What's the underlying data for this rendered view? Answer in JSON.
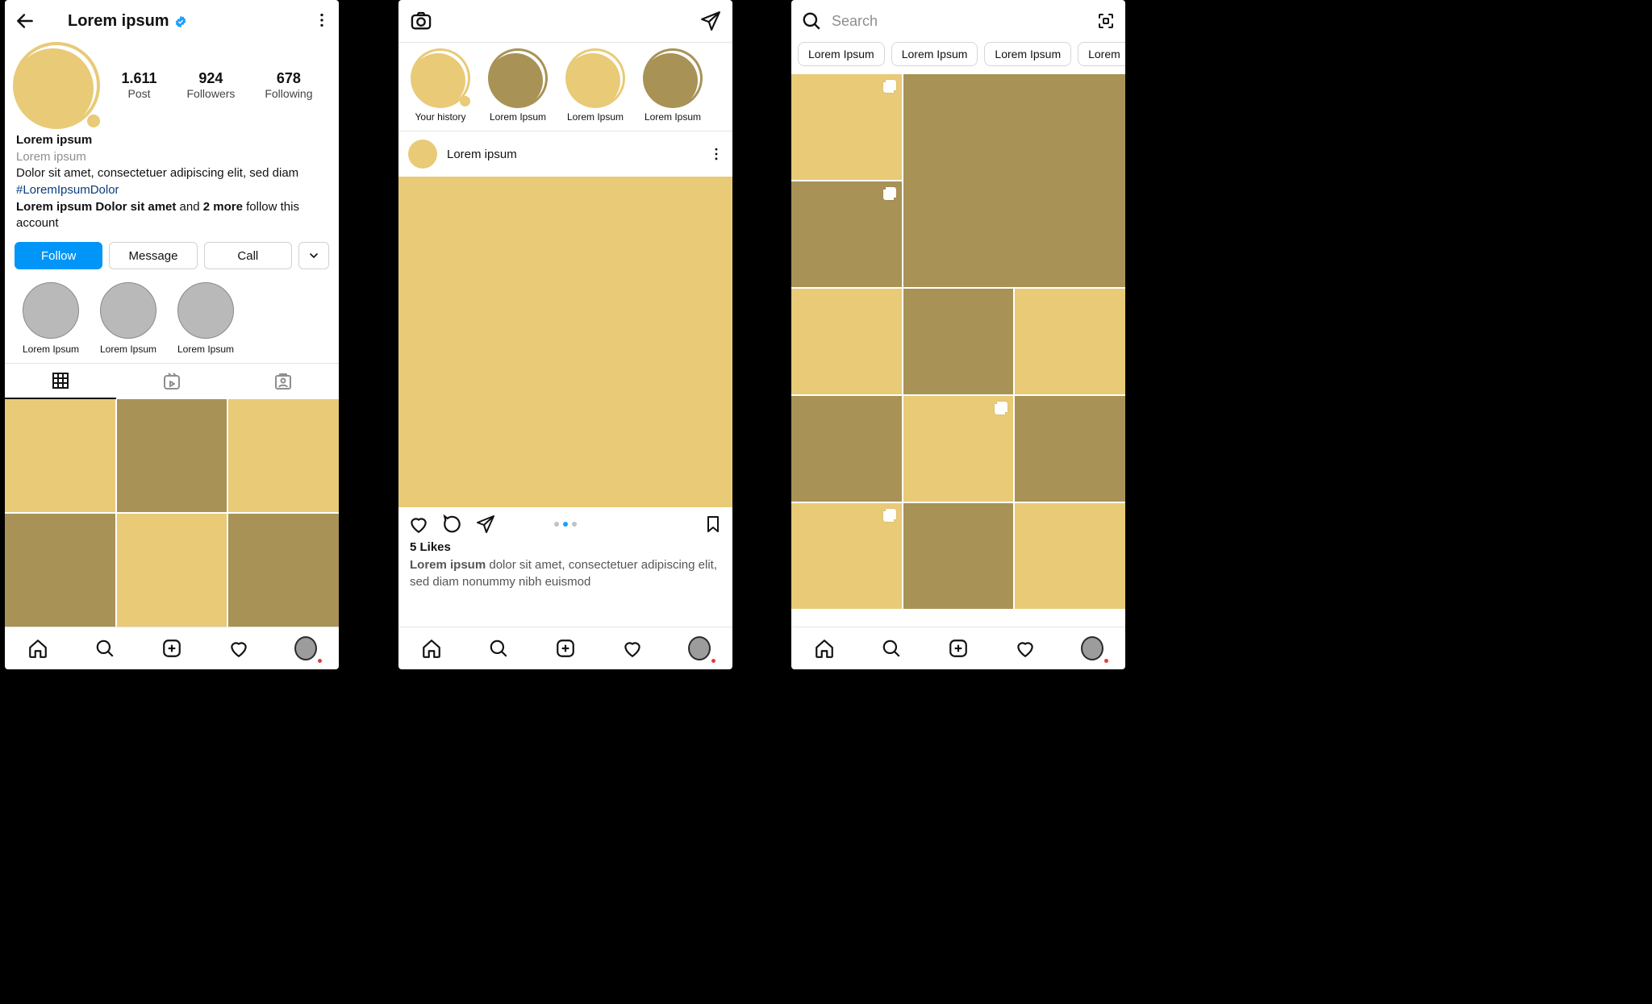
{
  "profile": {
    "username": "Lorem ipsum",
    "posts_count": "1.611",
    "posts_label": "Post",
    "followers_count": "924",
    "followers_label": "Followers",
    "following_count": "678",
    "following_label": "Following",
    "display_name": "Lorem ipsum",
    "category": "Lorem ipsum",
    "bio_pre": "Dolor sit amet, consectetuer adipiscing elit, sed diam ",
    "bio_hash": "#LoremIpsumDolor",
    "followed_by_name": "Lorem ipsum Dolor sit amet",
    "followed_by_mid": " and ",
    "followed_by_count": "2 more",
    "followed_by_suffix": " follow this account",
    "btn_follow": "Follow",
    "btn_message": "Message",
    "btn_call": "Call",
    "highlights": [
      "Lorem Ipsum",
      "Lorem Ipsum",
      "Lorem Ipsum"
    ]
  },
  "feed": {
    "stories": [
      "Your history",
      "Lorem Ipsum",
      "Lorem Ipsum",
      "Lorem Ipsum"
    ],
    "post_user": "Lorem ipsum",
    "likes": "5 Likes",
    "caption_user": "Lorem ipsum",
    "caption_text": " dolor sit amet, consectetuer adipiscing elit, sed diam nonummy nibh euismod"
  },
  "explore": {
    "search_placeholder": "Search",
    "chips": [
      "Lorem Ipsum",
      "Lorem Ipsum",
      "Lorem Ipsum",
      "Lorem"
    ]
  }
}
